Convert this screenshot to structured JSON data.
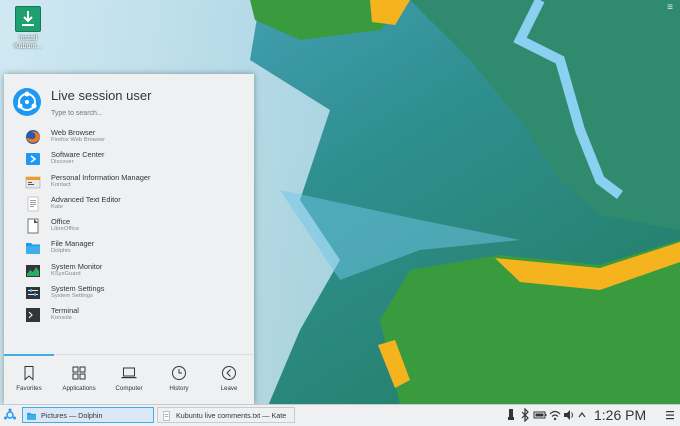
{
  "desktop": {
    "icon_label_line1": "Install",
    "icon_label_line2": "Kubunt..."
  },
  "menu": {
    "username": "Live session user",
    "search_placeholder": "Type to search...",
    "apps": [
      {
        "name": "Web Browser",
        "desc": "Firefox Web Browser",
        "icon": "firefox-icon"
      },
      {
        "name": "Software Center",
        "desc": "Discover",
        "icon": "software-center-icon"
      },
      {
        "name": "Personal Information Manager",
        "desc": "Kontact",
        "icon": "kontact-icon"
      },
      {
        "name": "Advanced Text Editor",
        "desc": "Kate",
        "icon": "text-editor-icon"
      },
      {
        "name": "Office",
        "desc": "LibreOffice",
        "icon": "office-icon"
      },
      {
        "name": "File Manager",
        "desc": "Dolphin",
        "icon": "folder-icon"
      },
      {
        "name": "System Monitor",
        "desc": "KSysGuard",
        "icon": "system-monitor-icon"
      },
      {
        "name": "System Settings",
        "desc": "System Settings",
        "icon": "settings-icon"
      },
      {
        "name": "Terminal",
        "desc": "Konsole",
        "icon": "terminal-icon"
      }
    ],
    "tabs": [
      {
        "label": "Favorites",
        "icon": "bookmark-icon"
      },
      {
        "label": "Applications",
        "icon": "grid-icon"
      },
      {
        "label": "Computer",
        "icon": "laptop-icon"
      },
      {
        "label": "History",
        "icon": "clock-icon"
      },
      {
        "label": "Leave",
        "icon": "leave-icon"
      }
    ]
  },
  "taskbar": {
    "tasks": [
      {
        "label": "Pictures — Dolphin",
        "icon": "folder-icon"
      },
      {
        "label": "Kubuntu live comments.txt  — Kate",
        "icon": "text-editor-icon"
      }
    ],
    "clock": "1:26 PM"
  },
  "colors": {
    "accent": "#3daee9",
    "panel_bg": "#eff0f1",
    "text": "#31363b",
    "subtext": "#7f8c8d"
  }
}
